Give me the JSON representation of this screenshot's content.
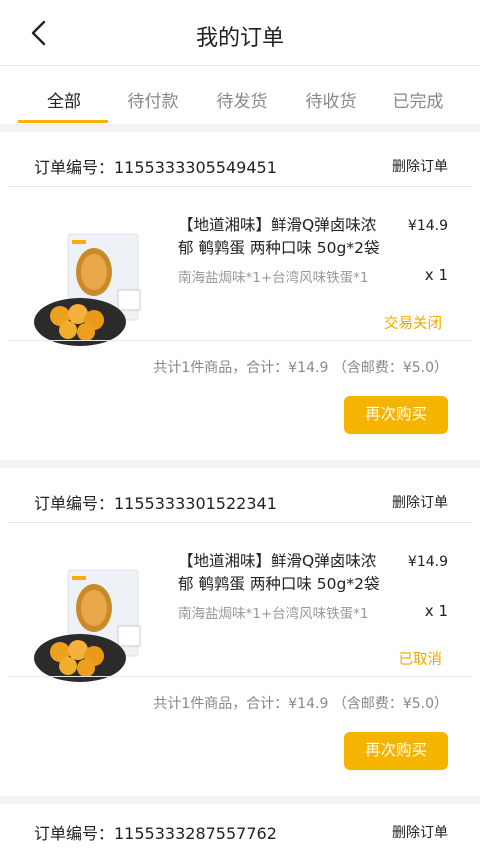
{
  "header": {
    "title": "我的订单",
    "back_icon": "chevron-left-icon"
  },
  "tabs": [
    {
      "label": "全部",
      "active": true
    },
    {
      "label": "待付款",
      "active": false
    },
    {
      "label": "待发货",
      "active": false
    },
    {
      "label": "待收货",
      "active": false
    },
    {
      "label": "已完成",
      "active": false
    }
  ],
  "orders": [
    {
      "order_no": "订单编号：1155333305549451",
      "delete_label": "删除订单",
      "product_name": "【地道湘味】鲜滑Q弹卤味浓郁 鹌鹑蛋 两种口味 50g*2袋",
      "price": "¥14.9",
      "spec": "南海盐焗味*1+台湾风味铁蛋*1",
      "qty": "x 1",
      "status": "交易关闭",
      "summary": "共计1件商品，合计：¥14.9 （含邮费：¥5.0）",
      "rebuy_label": "再次购买"
    },
    {
      "order_no": "订单编号：1155333301522341",
      "delete_label": "删除订单",
      "product_name": "【地道湘味】鲜滑Q弹卤味浓郁 鹌鹑蛋 两种口味 50g*2袋",
      "price": "¥14.9",
      "spec": "南海盐焗味*1+台湾风味铁蛋*1",
      "qty": "x 1",
      "status": "已取消",
      "summary": "共计1件商品，合计：¥14.9 （含邮费：¥5.0）",
      "rebuy_label": "再次购买"
    },
    {
      "order_no": "订单编号：1155333287557762",
      "delete_label": "删除订单"
    }
  ],
  "colors": {
    "accent": "#f5b400",
    "status": "#f0a800",
    "separator": "#f2f2f2"
  }
}
